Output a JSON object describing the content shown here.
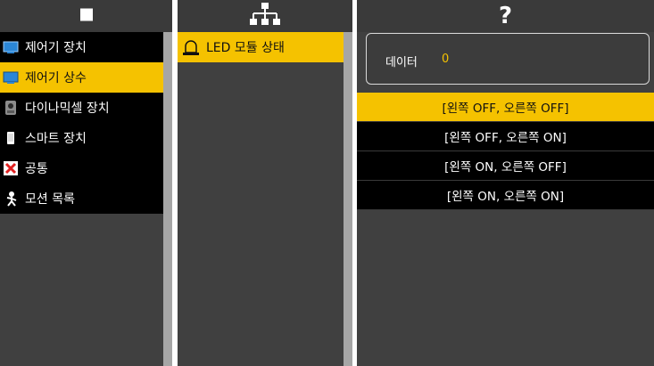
{
  "left_panel": {
    "header_icon": "stop-square-icon",
    "items": [
      {
        "label": "제어기 장치",
        "icon": "monitor-icon",
        "selected": false
      },
      {
        "label": "제어기 상수",
        "icon": "monitor-icon",
        "selected": true
      },
      {
        "label": "다이나믹셀 장치",
        "icon": "servo-icon",
        "selected": false
      },
      {
        "label": "스마트 장치",
        "icon": "phone-icon",
        "selected": false
      },
      {
        "label": "공통",
        "icon": "tools-icon",
        "selected": false
      },
      {
        "label": "모션 목록",
        "icon": "robot-icon",
        "selected": false
      }
    ]
  },
  "middle_panel": {
    "header_icon": "network-tree-icon",
    "items": [
      {
        "label": "LED 모듈 상태",
        "icon": "alarm-light-icon",
        "selected": true
      }
    ]
  },
  "right_panel": {
    "header_icon": "help-question-icon",
    "header_symbol": "?",
    "data_box": {
      "label": "데이터",
      "value": "0"
    },
    "options": [
      {
        "label": "[왼쪽 OFF, 오른쪽 OFF]",
        "selected": true
      },
      {
        "label": "[왼쪽 OFF, 오른쪽 ON]",
        "selected": false
      },
      {
        "label": "[왼쪽 ON, 오른쪽 OFF]",
        "selected": false
      },
      {
        "label": "[왼쪽 ON, 오른쪽 ON]",
        "selected": false
      }
    ]
  },
  "colors": {
    "accent": "#f5c200",
    "panel_bg": "#404040",
    "list_bg": "#000000",
    "scrollbar": "#a6a6a6"
  }
}
